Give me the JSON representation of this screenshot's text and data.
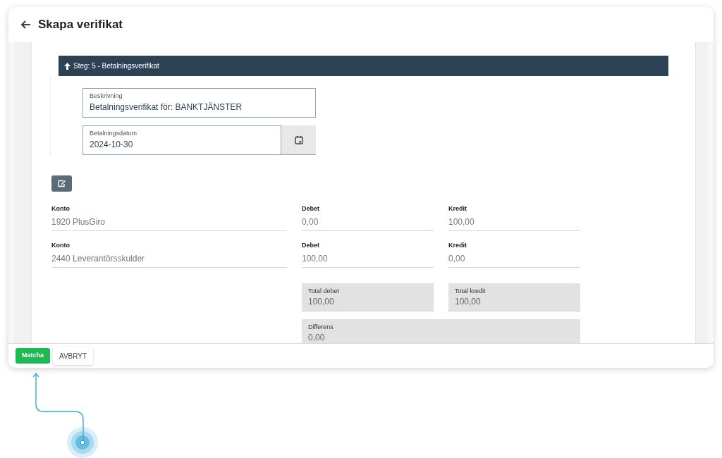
{
  "header": {
    "title": "Skapa verifikat"
  },
  "step": {
    "title": "Steg: 5 - Betalningsverifikat",
    "expanded": true
  },
  "description": {
    "label": "Beskrivning",
    "value": "Betalningsverifikat för: BANKTJÄNSTER"
  },
  "payment_date": {
    "label": "Betalningsdatum",
    "value": "2024-10-30"
  },
  "rows": [
    {
      "account_label": "Konto",
      "account": "1920 PlusGiro",
      "debit_label": "Debet",
      "debit": "0,00",
      "credit_label": "Kredit",
      "credit": "100,00"
    },
    {
      "account_label": "Konto",
      "account": "2440 Leverantörsskulder",
      "debit_label": "Debet",
      "debit": "100,00",
      "credit_label": "Kredit",
      "credit": "0,00"
    }
  ],
  "totals": [
    {
      "label": "Total debet",
      "value": "100,00"
    },
    {
      "label": "Total kredit",
      "value": "100,00"
    }
  ],
  "difference": {
    "label": "Differens",
    "value": "0,00"
  },
  "buttons": [
    {
      "label": "Matcha",
      "kind": "primary"
    },
    {
      "label": "AVBRYT",
      "kind": "secondary"
    }
  ]
}
